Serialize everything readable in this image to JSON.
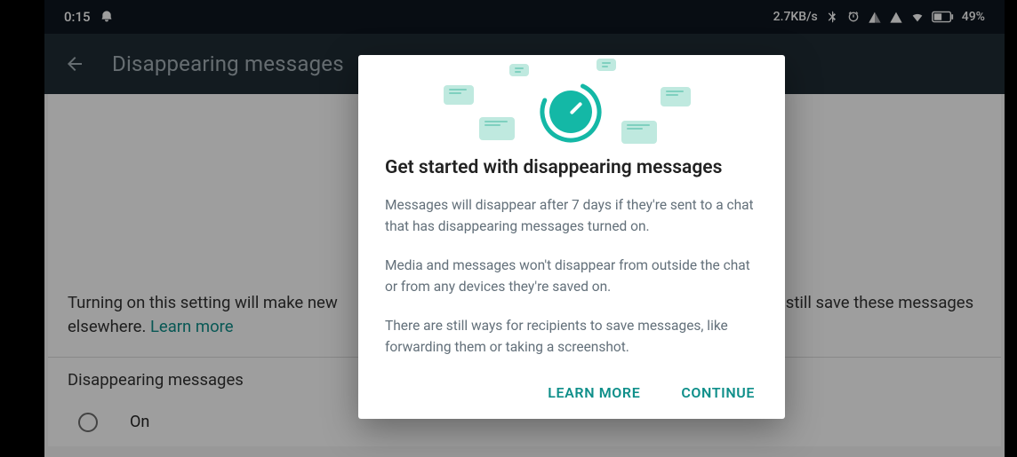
{
  "status_bar": {
    "time": "0:15",
    "net_speed": "2.7KB/s",
    "battery": "49%"
  },
  "app_bar": {
    "title": "Disappearing messages"
  },
  "settings": {
    "description_prefix": "Turning on this setting will make new",
    "description_suffix": "an still save these messages elsewhere.",
    "learn_more": "Learn more",
    "section_label": "Disappearing messages",
    "radio_on": "On"
  },
  "dialog": {
    "title": "Get started with disappearing messages",
    "para1": "Messages will disappear after 7 days if they're sent to a chat that has disappearing messages turned on.",
    "para2": "Media and messages won't disappear from outside the chat or from any devices they're saved on.",
    "para3": "There are still ways for recipients to save messages, like forwarding them or taking a screenshot.",
    "learn_more": "LEARN MORE",
    "continue": "CONTINUE"
  }
}
